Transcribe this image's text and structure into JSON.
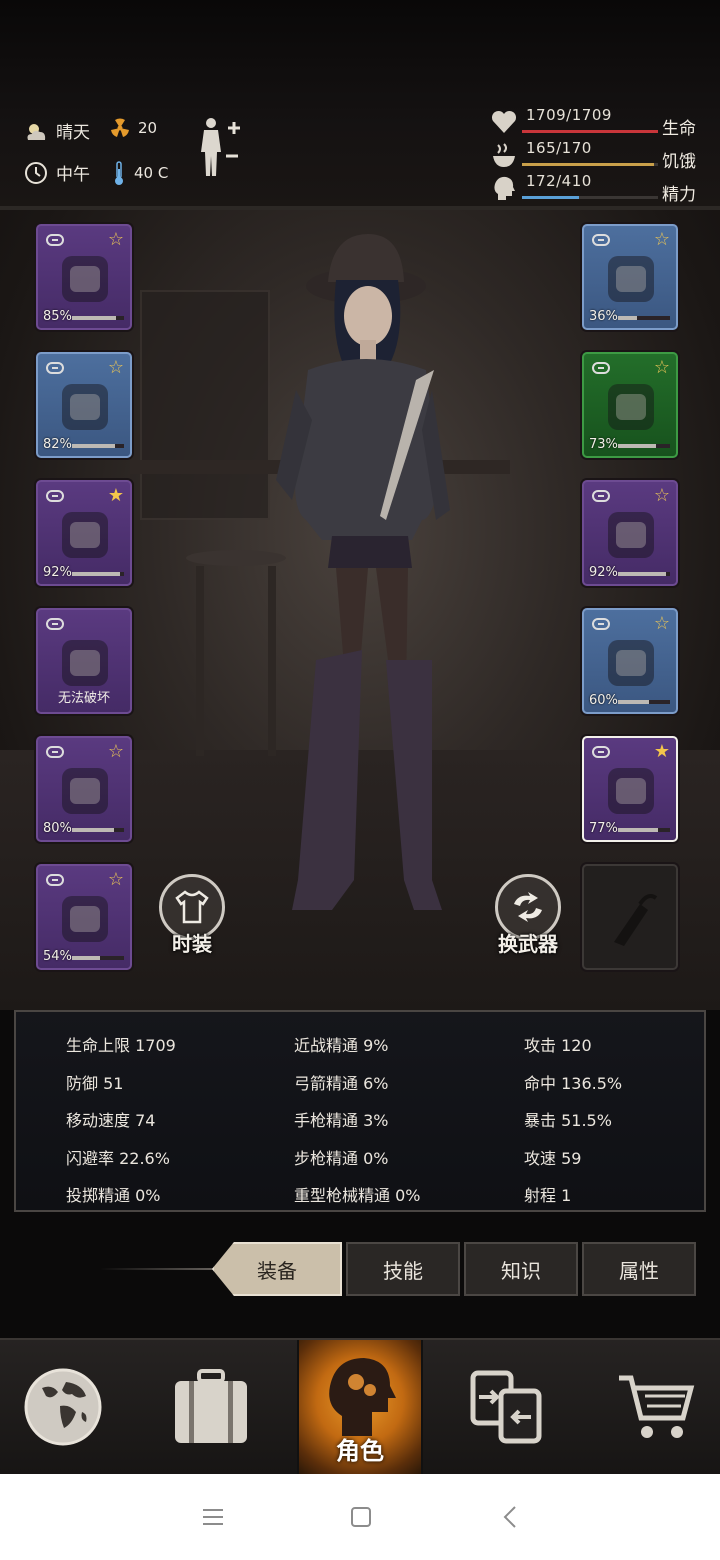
{
  "status": {
    "weather": "晴天",
    "radiation": "20",
    "time": "中午",
    "temperature": "40 C"
  },
  "vitals": [
    {
      "value": "1709/1709",
      "label": "生命",
      "fraction": 1.0,
      "color": "#c9353a"
    },
    {
      "value": "165/170",
      "label": "饥饿",
      "fraction": 0.97,
      "color": "#c9a04a"
    },
    {
      "value": "172/410",
      "label": "精力",
      "fraction": 0.42,
      "color": "#5aa0d8"
    }
  ],
  "left_slots": [
    {
      "icon": "police-helmet-icon",
      "pct": "85%",
      "durability": 0.85,
      "rarity": "purple",
      "star": "outline"
    },
    {
      "icon": "long-sleeve-shirt-icon",
      "pct": "82%",
      "durability": 0.82,
      "rarity": "blue",
      "star": "outline"
    },
    {
      "icon": "police-jacket-icon",
      "pct": "92%",
      "durability": 0.92,
      "rarity": "purple",
      "star": "filled"
    },
    {
      "icon": "backpack-icon",
      "caption": "无法破坏",
      "rarity": "purple"
    },
    {
      "icon": "cargo-pants-icon",
      "pct": "80%",
      "durability": 0.8,
      "rarity": "purple",
      "star": "outline"
    },
    {
      "icon": "combat-boots-icon",
      "pct": "54%",
      "durability": 0.54,
      "rarity": "purple",
      "star": "outline"
    }
  ],
  "right_slots": [
    {
      "icon": "sunglasses-icon",
      "pct": "36%",
      "durability": 0.36,
      "rarity": "blue",
      "star": "outline"
    },
    {
      "icon": "gas-mask-icon",
      "pct": "73%",
      "durability": 0.73,
      "rarity": "green",
      "star": "outline"
    },
    {
      "icon": "police-vest-icon",
      "pct": "92%",
      "durability": 0.92,
      "rarity": "purple",
      "star": "outline"
    },
    {
      "icon": "riot-shield-icon",
      "pct": "60%",
      "durability": 0.6,
      "rarity": "blue",
      "star": "outline"
    },
    {
      "icon": "machete-icon",
      "pct": "77%",
      "durability": 0.77,
      "rarity": "purple",
      "star": "filled",
      "selected": true
    },
    {
      "icon": "empty-weapon-slot-icon",
      "rarity": "empty"
    }
  ],
  "buttons": {
    "outfit": "时装",
    "switch_weapon": "换武器"
  },
  "stats": [
    [
      "生命上限 1709",
      "近战精通 9%",
      "攻击 120"
    ],
    [
      "防御 51",
      "弓箭精通 6%",
      "命中 136.5%"
    ],
    [
      "移动速度 74",
      "手枪精通 3%",
      "暴击 51.5%"
    ],
    [
      "闪避率 22.6%",
      "步枪精通 0%",
      "攻速 59"
    ],
    [
      "投掷精通 0%",
      "重型枪械精通 0%",
      "射程 1"
    ]
  ],
  "tabs": [
    {
      "label": "装备",
      "active": true
    },
    {
      "label": "技能",
      "active": false
    },
    {
      "label": "知识",
      "active": false
    },
    {
      "label": "属性",
      "active": false
    }
  ],
  "nav": [
    {
      "icon": "world-map-icon",
      "label": ""
    },
    {
      "icon": "suitcase-icon",
      "label": ""
    },
    {
      "icon": "character-head-icon",
      "label": "角色",
      "active": true
    },
    {
      "icon": "trade-icon",
      "label": ""
    },
    {
      "icon": "shopping-cart-icon",
      "label": ""
    }
  ],
  "system_bar": [
    "menu-icon",
    "home-icon",
    "back-icon"
  ]
}
